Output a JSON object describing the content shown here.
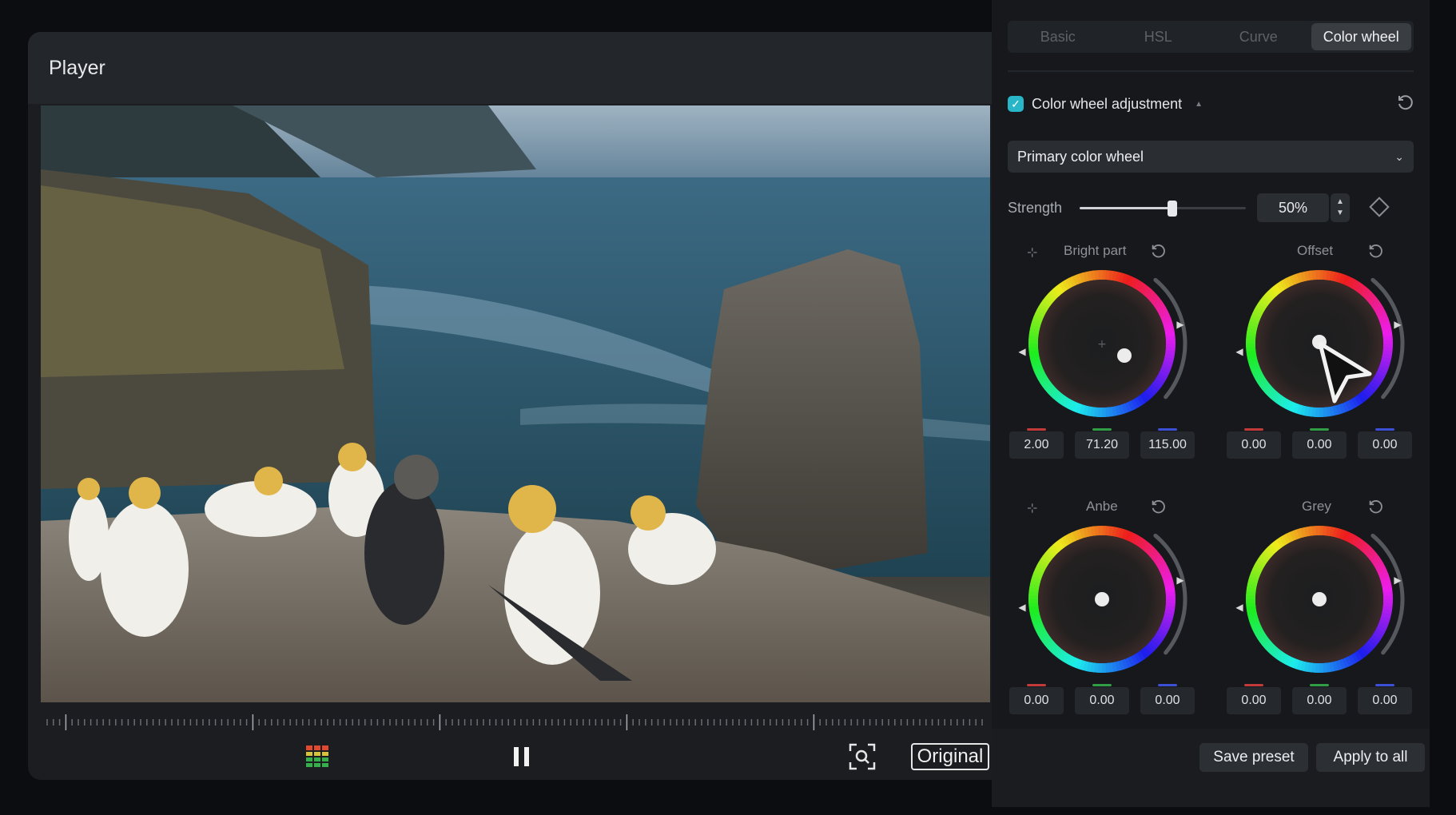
{
  "player": {
    "title": "Player",
    "original_label": "Original"
  },
  "tabs": [
    {
      "label": "Basic",
      "active": false
    },
    {
      "label": "HSL",
      "active": false
    },
    {
      "label": "Curve",
      "active": false
    },
    {
      "label": "Color wheel",
      "active": true
    }
  ],
  "adjustment": {
    "label": "Color wheel adjustment",
    "checked": true,
    "mode": "Primary color wheel"
  },
  "strength": {
    "label": "Strength",
    "value_text": "50%",
    "value": 0.5
  },
  "wheels": {
    "bright": {
      "label": "Bright part",
      "r": "2.00",
      "g": "71.20",
      "b": "115.00"
    },
    "offset": {
      "label": "Offset",
      "r": "0.00",
      "g": "0.00",
      "b": "0.00"
    },
    "anbe": {
      "label": "Anbe",
      "r": "0.00",
      "g": "0.00",
      "b": "0.00"
    },
    "grey": {
      "label": "Grey",
      "r": "0.00",
      "g": "0.00",
      "b": "0.00"
    }
  },
  "footer": {
    "save_preset": "Save preset",
    "apply_all": "Apply to all"
  },
  "colors": {
    "accent": "#29b6c9",
    "panel_bg": "#16181c"
  }
}
